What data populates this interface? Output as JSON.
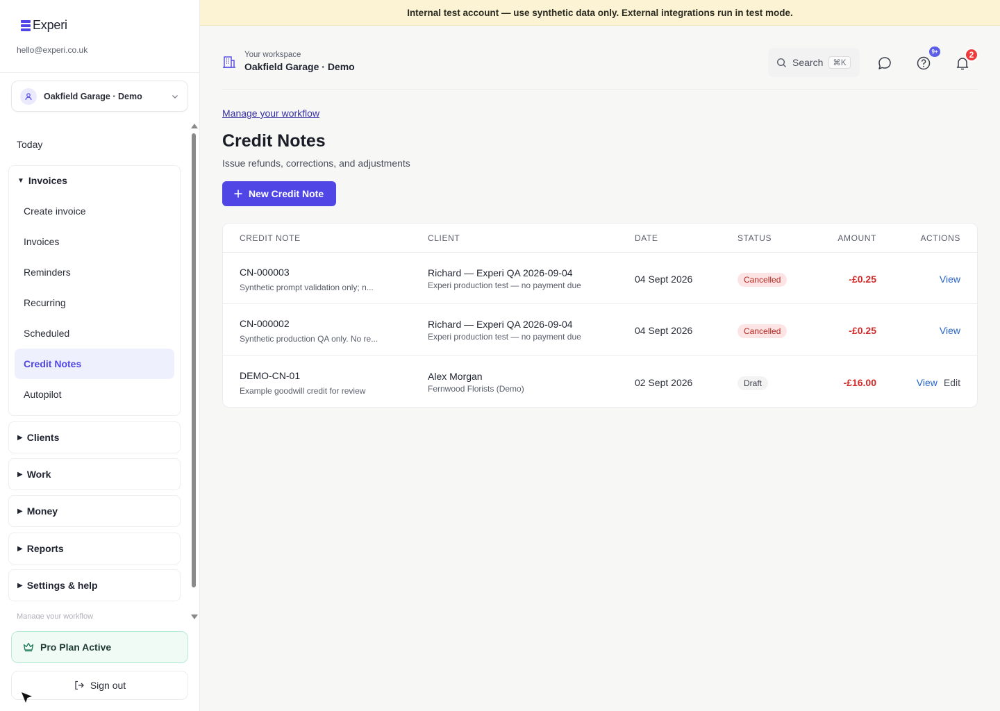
{
  "banner": {
    "text": "Internal test account — use synthetic data only. External integrations run in test mode."
  },
  "sidebar": {
    "brand": "Experi",
    "email": "hello@experi.co.uk",
    "workspace_select": {
      "value": "Oakfield Garage · Demo"
    },
    "today_label": "Today",
    "invoices_group": {
      "title": "Invoices",
      "items": [
        {
          "label": "Create invoice"
        },
        {
          "label": "Invoices"
        },
        {
          "label": "Reminders"
        },
        {
          "label": "Recurring"
        },
        {
          "label": "Scheduled"
        },
        {
          "label": "Credit Notes",
          "active": true
        },
        {
          "label": "Autopilot"
        }
      ]
    },
    "groups": [
      {
        "title": "Clients"
      },
      {
        "title": "Work"
      },
      {
        "title": "Money"
      },
      {
        "title": "Reports"
      },
      {
        "title": "Settings & help"
      }
    ],
    "faded_link": "Manage your workflow",
    "pro_plan_label": "Pro Plan Active",
    "signout_label": "Sign out"
  },
  "header": {
    "workspace_label": "Your workspace",
    "workspace_name": "Oakfield Garage · Demo",
    "search_label": "Search",
    "search_shortcut": "⌘K",
    "help_badge": "9+",
    "notification_badge": "2"
  },
  "page": {
    "breadcrumb_link": "Manage your workflow",
    "title": "Credit Notes",
    "subtitle": "Issue refunds, corrections, and adjustments",
    "new_button_label": "New Credit Note"
  },
  "table": {
    "columns": [
      "CREDIT NOTE",
      "CLIENT",
      "DATE",
      "STATUS",
      "AMOUNT",
      "ACTIONS"
    ],
    "rows": [
      {
        "number": "CN-000003",
        "description": "Synthetic prompt validation only; n...",
        "client": "Richard — Experi QA 2026-09-04",
        "client_sub": "Experi production test — no payment due",
        "date": "04 Sept 2026",
        "status": "Cancelled",
        "amount": "-£0.25",
        "actions": [
          "View"
        ]
      },
      {
        "number": "CN-000002",
        "description": "Synthetic production QA only. No re...",
        "client": "Richard — Experi QA 2026-09-04",
        "client_sub": "Experi production test — no payment due",
        "date": "04 Sept 2026",
        "status": "Cancelled",
        "amount": "-£0.25",
        "actions": [
          "View"
        ]
      },
      {
        "number": "DEMO-CN-01",
        "description": "Example goodwill credit for review",
        "client": "Alex Morgan",
        "client_sub": "Fernwood Florists (Demo)",
        "date": "02 Sept 2026",
        "status": "Draft",
        "amount": "-£16.00",
        "actions": [
          "View",
          "Edit"
        ]
      }
    ]
  },
  "colors": {
    "accent": "#4f46e5",
    "banner_bg": "#fbf3d3",
    "negative_amount": "#d12828",
    "cancelled_bg": "#fde4e4",
    "link": "#2563c9"
  }
}
